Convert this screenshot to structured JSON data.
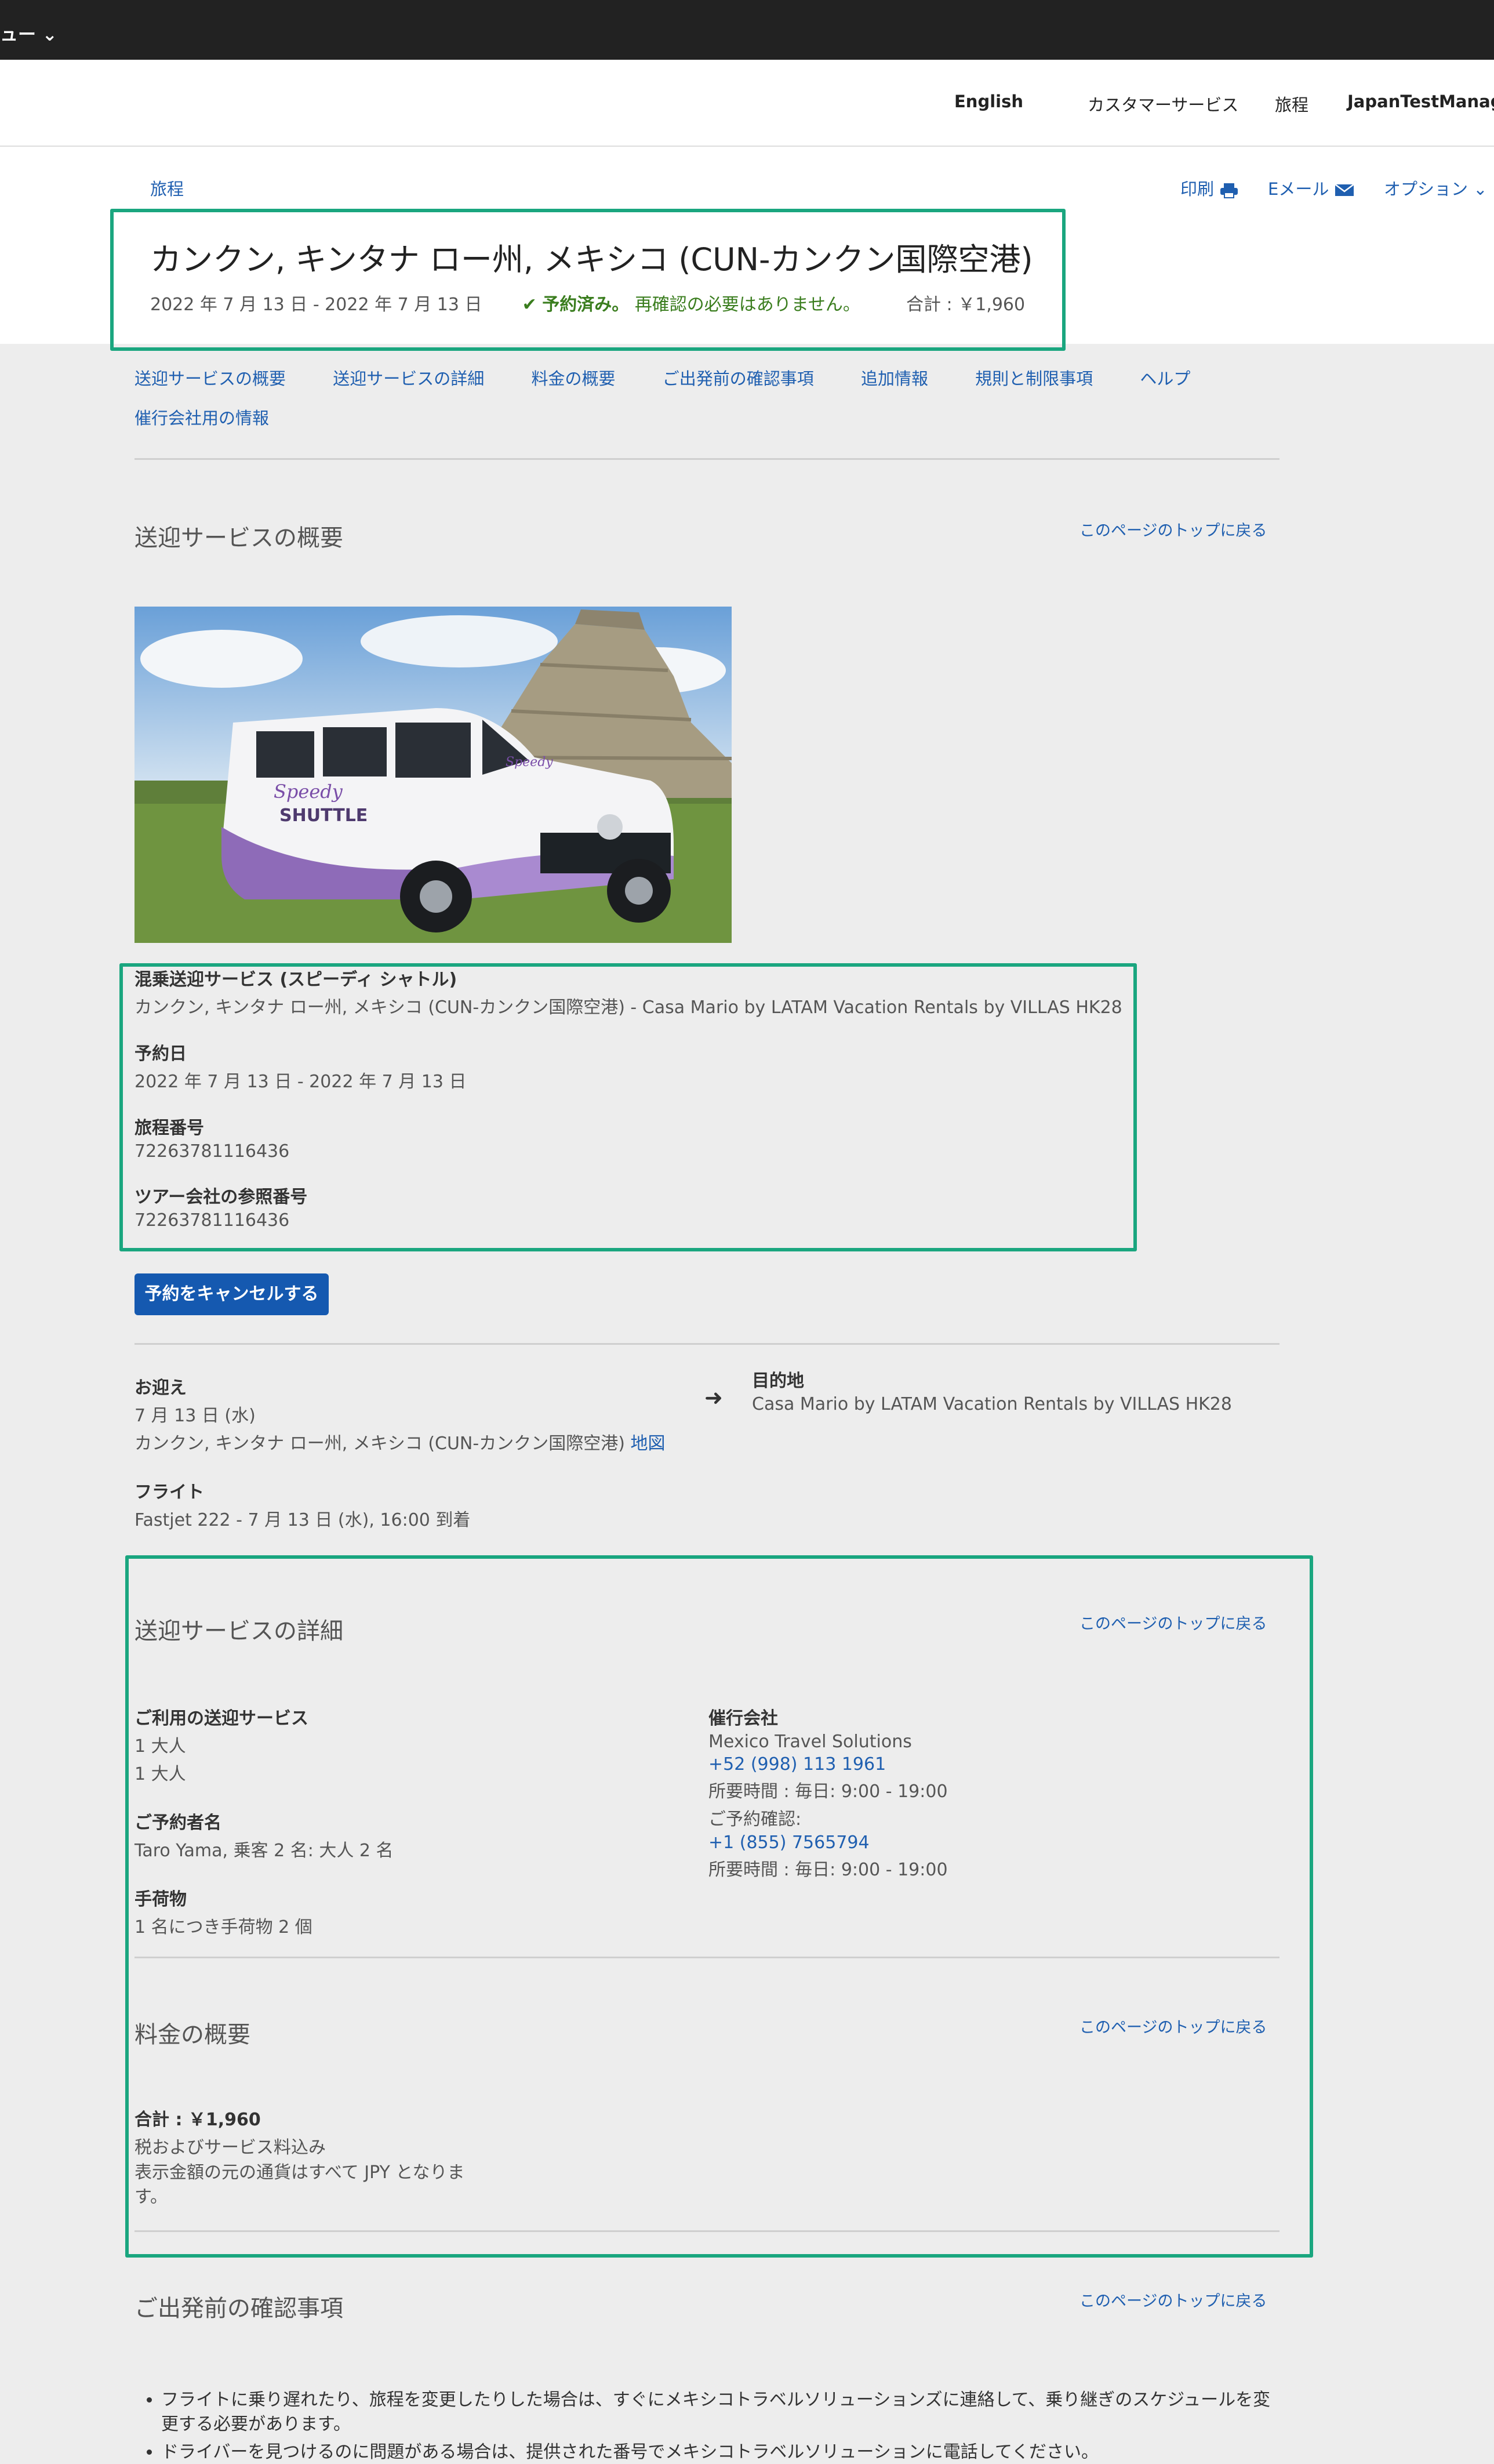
{
  "topbar": {
    "menu_label": "ュー ⌄"
  },
  "header": {
    "language": "English",
    "customer_service": "カスタマーサービス",
    "itinerary": "旅程",
    "account": "JapanTestManager"
  },
  "page": {
    "breadcrumb": "旅程",
    "print_label": "印刷",
    "email_label": "Eメール",
    "options_label": "オプション",
    "title": "カンクン, キンタナ ロー州, メキシコ (CUN-カンクン国際空港)",
    "dates": "2022 年 7 月 13 日 - 2022 年 7 月 13 日",
    "status_bold": "予約済み。",
    "status_note": "再確認の必要はありません。",
    "total": "合計 : ￥1,960"
  },
  "nav": {
    "items": [
      "送迎サービスの概要",
      "送迎サービスの詳細",
      "料金の概要",
      "ご出発前の確認事項",
      "追加情報",
      "規則と制限事項",
      "ヘルプ"
    ],
    "second_row": "催行会社用の情報"
  },
  "overview": {
    "title": "送迎サービスの概要",
    "back_to_top": "このページのトップに戻る",
    "image_alt": "Speedy SHUTTLE van",
    "van_brand_top": "Speedy",
    "van_brand_bottom": "SHUTTLE",
    "service_name": "混乗送迎サービス (スピーディ シャトル)",
    "route": "カンクン, キンタナ ロー州, メキシコ (CUN-カンクン国際空港) - Casa Mario by LATAM Vacation Rentals by VILLAS HK28",
    "booking_date_label": "予約日",
    "booking_date": "2022 年 7 月 13 日 - 2022 年 7 月 13 日",
    "itinerary_no_label": "旅程番号",
    "itinerary_no": "72263781116436",
    "tour_ref_label": "ツアー会社の参照番号",
    "tour_ref": "72263781116436",
    "cancel_button": "予約をキャンセルする",
    "pickup_label": "お迎え",
    "pickup_date": "7 月 13 日 (水)",
    "pickup_place": "カンクン, キンタナ ロー州, メキシコ (CUN-カンクン国際空港)",
    "map_link": "地図",
    "destination_label": "目的地",
    "destination": "Casa Mario by LATAM Vacation Rentals by VILLAS HK28",
    "flight_label": "フライト",
    "flight": "Fastjet 222 - 7 月 13 日 (水), 16:00 到着"
  },
  "details": {
    "title": "送迎サービスの詳細",
    "back_to_top": "このページのトップに戻る",
    "service_label": "ご利用の送迎サービス",
    "service_line1": "1 大人",
    "service_line2": "1 大人",
    "booker_label": "ご予約者名",
    "booker": "Taro Yama, 乗客 2 名: 大人 2 名",
    "luggage_label": "手荷物",
    "luggage": "1 名につき手荷物 2 個",
    "operator_label": "催行会社",
    "operator": "Mexico Travel Solutions",
    "operator_phone": "+52 (998) 113 1961",
    "operator_hours": "所要時間 : 毎日: 9:00 - 19:00",
    "confirm_label": "ご予約確認:",
    "confirm_phone": "+1 (855) 7565794",
    "confirm_hours": "所要時間 : 毎日: 9:00 - 19:00"
  },
  "pricing": {
    "title": "料金の概要",
    "back_to_top": "このページのトップに戻る",
    "total": "合計 : ￥1,960",
    "tax_note": "税およびサービス料込み",
    "currency_note": "表示金額の元の通貨はすべて JPY となります。"
  },
  "before_departure": {
    "title": "ご出発前の確認事項",
    "back_to_top": "このページのトップに戻る",
    "note1": "フライトに乗り遅れたり、旅程を変更したりした場合は、すぐにメキシコトラベルソリューションズに連絡して、乗り継ぎのスケジュールを変更する必要があります。",
    "note2": "ドライバーを見つけるのに問題がある場合は、提供された番号でメキシコトラベルソリューションに電話してください。"
  },
  "colors": {
    "accent": "#1559b0",
    "highlight": "#1aa67f",
    "success": "#3a7d1e"
  }
}
